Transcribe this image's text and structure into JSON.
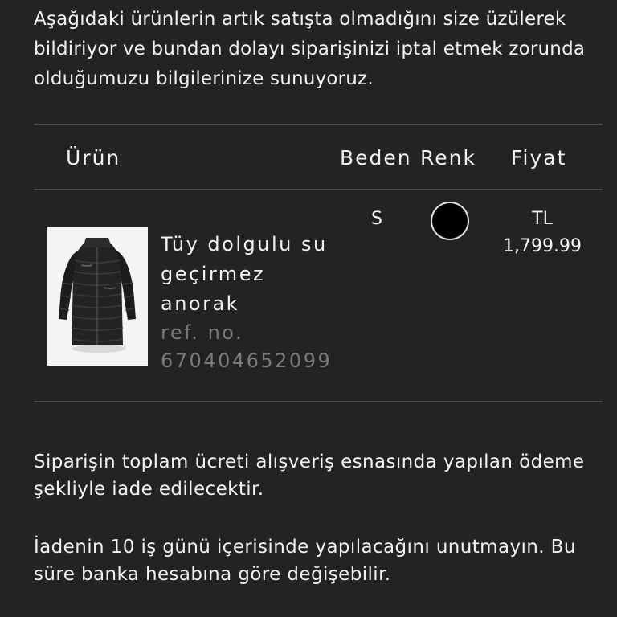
{
  "intro": {
    "text": "Aşağıdaki ürünlerin artık satışta olmadığını size üzülerek bildiriyor ve bundan dolayı siparişinizi iptal etmek zorunda olduğumuzu bilgilerinize sunuyoruz."
  },
  "table": {
    "headers": {
      "product": "Ürün",
      "size": "Beden",
      "color": "Renk",
      "price": "Fiyat"
    },
    "row": {
      "product_name": "Tüy dolgulu su geçirmez anorak",
      "ref_label": "ref. no.",
      "ref_number": "670404652099",
      "size": "S",
      "color_hex": "#000000",
      "currency": "TL",
      "price": "1,799.99",
      "image_icon": "black-puffer-coat-image"
    }
  },
  "footer": {
    "refund_text": "Siparişin toplam ücreti alışveriş esnasında yapılan ödeme şekliyle iade edilecektir.",
    "notice_text": "İadenin 10 iş günü içerisinde yapılacağını unutmayın. Bu süre banka hesabına göre değişebilir."
  }
}
